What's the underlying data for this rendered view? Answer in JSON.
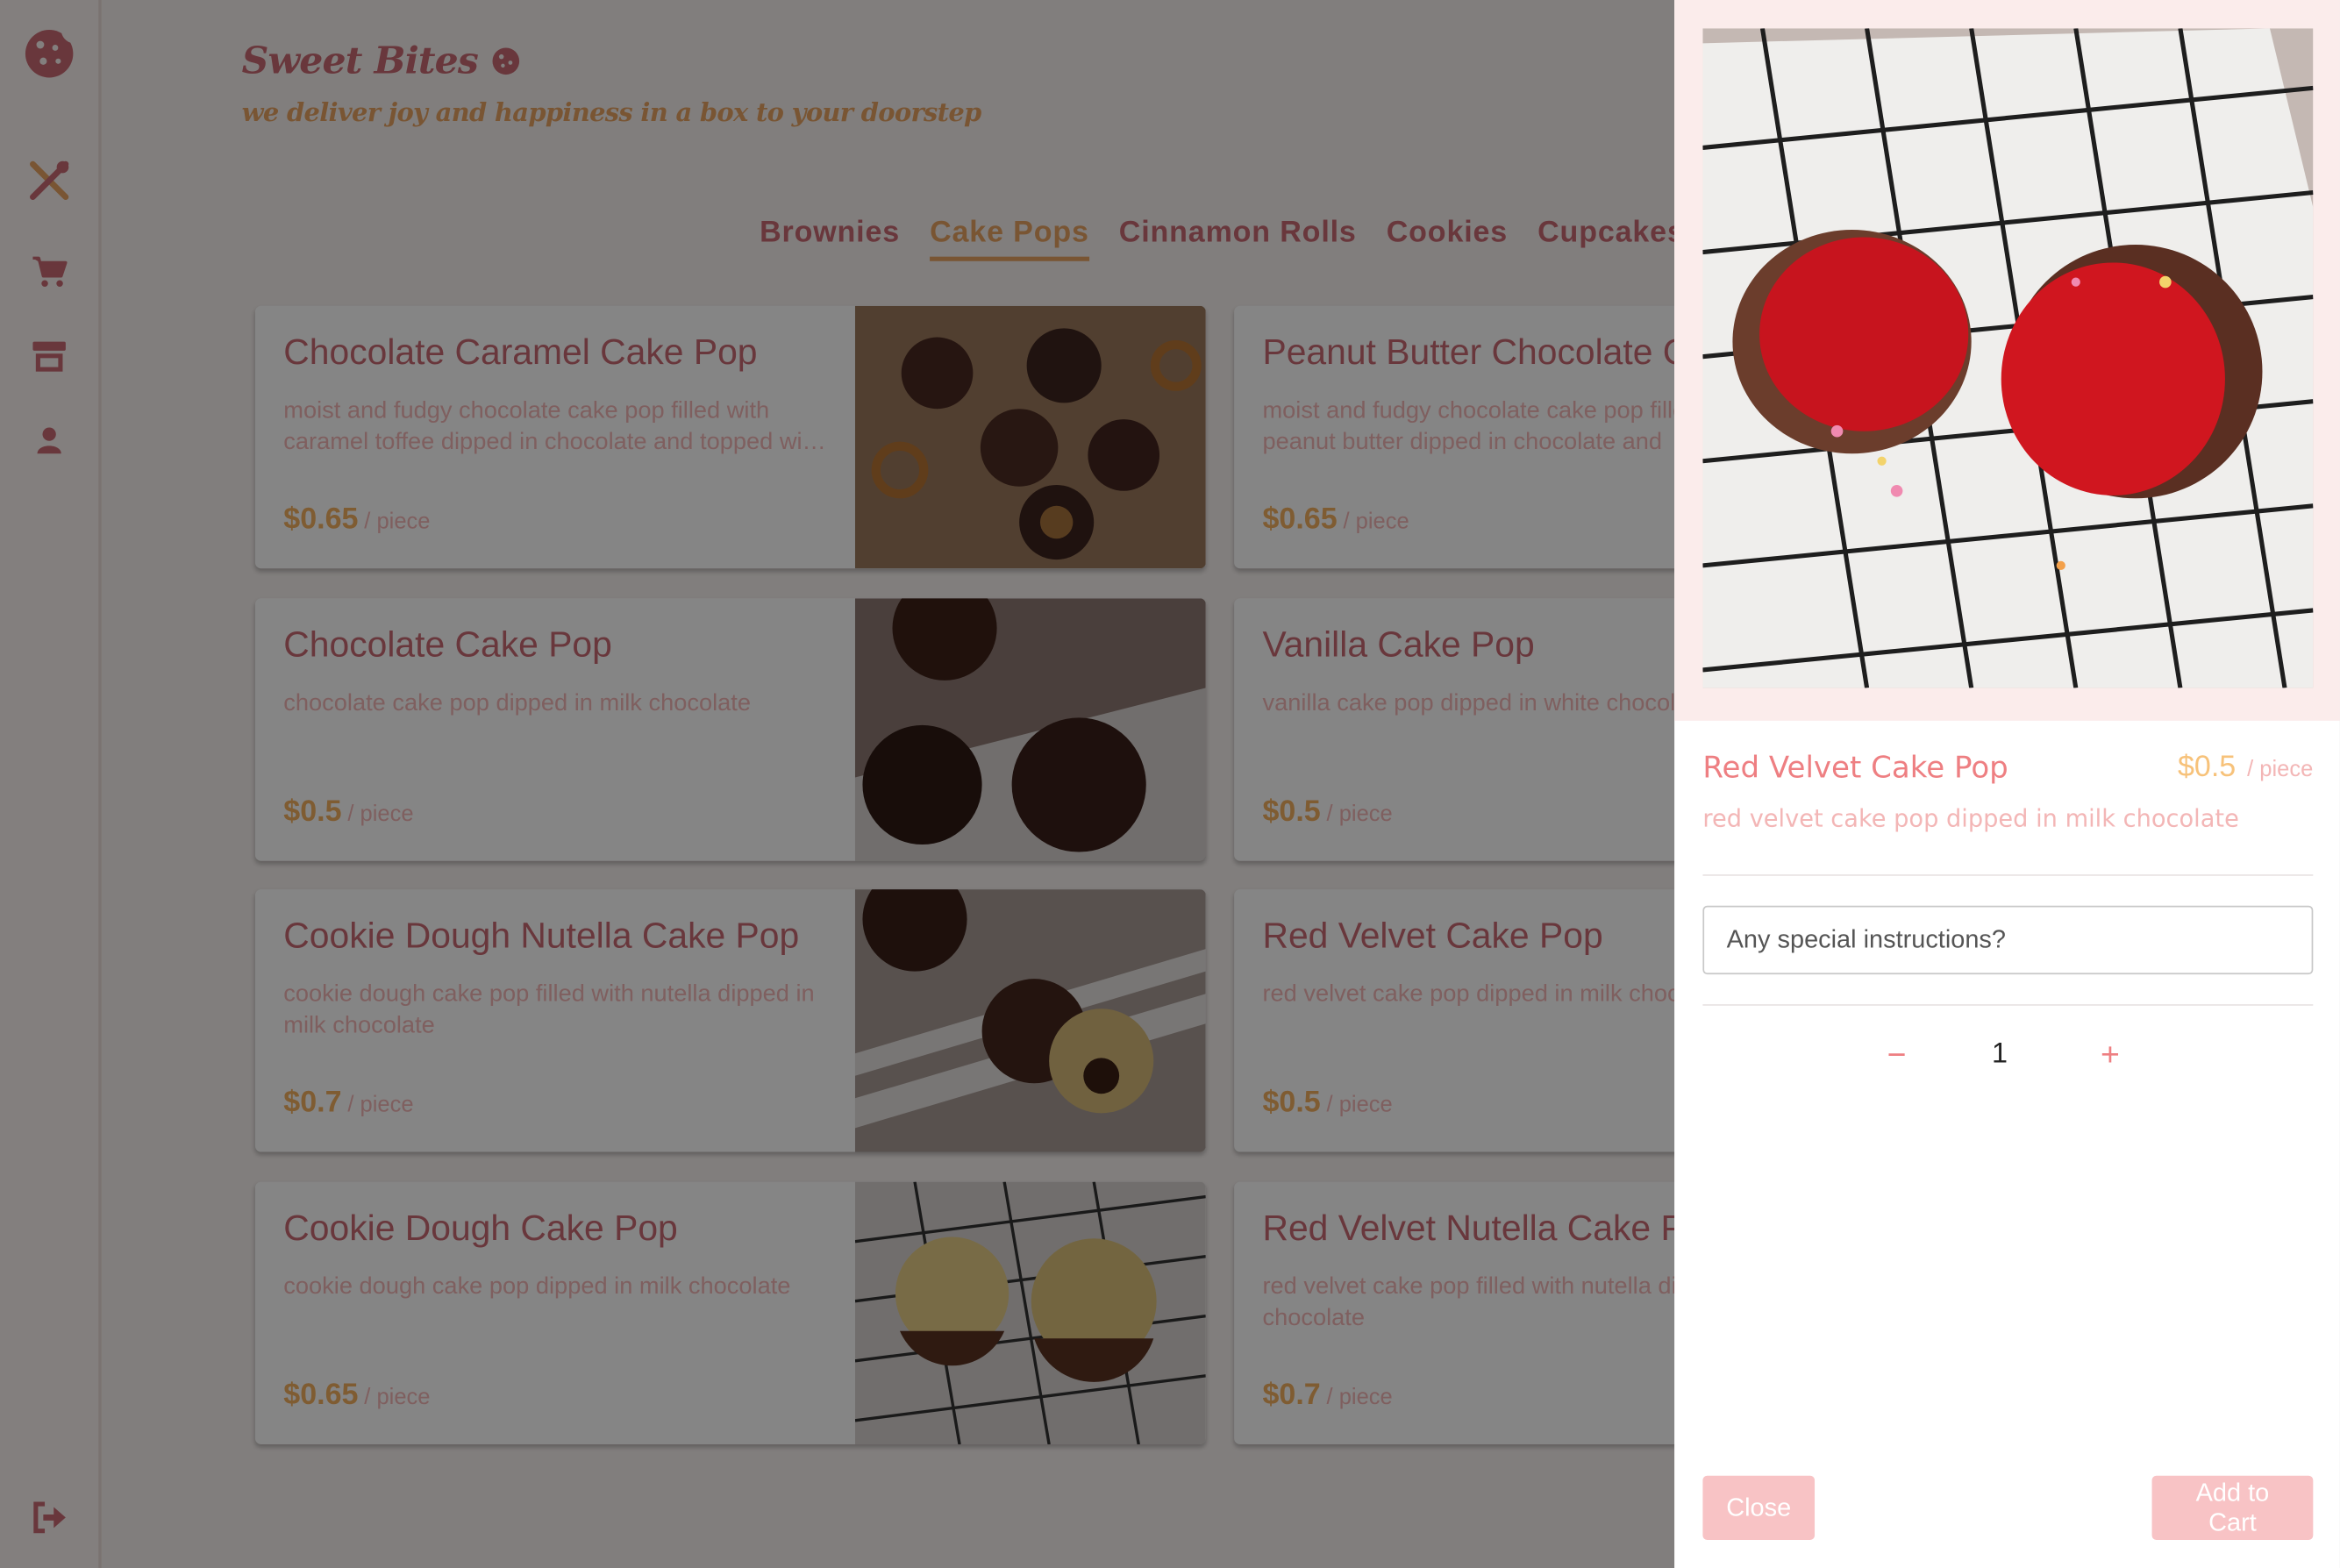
{
  "brand": {
    "name": "Sweet Bites",
    "tagline": "we deliver joy and happiness in a box to your doorstep"
  },
  "sidebar": {
    "items": [
      {
        "icon": "cookie-icon"
      },
      {
        "icon": "utensils-icon"
      },
      {
        "icon": "cart-icon"
      },
      {
        "icon": "store-icon"
      },
      {
        "icon": "user-icon"
      },
      {
        "icon": "logout-icon"
      }
    ]
  },
  "tabs": [
    {
      "label": "Brownies"
    },
    {
      "label": "Cake Pops",
      "active": true
    },
    {
      "label": "Cinnamon Rolls"
    },
    {
      "label": "Cookies"
    },
    {
      "label": "Cupcakes"
    }
  ],
  "products": [
    {
      "name": "Chocolate Caramel Cake Pop",
      "desc": "moist and fudgy chocolate cake pop filled with caramel toffee dipped in chocolate and topped with pretzel",
      "price": "$0.65",
      "unit": "/ piece"
    },
    {
      "name": "Peanut Butter Chocolate Cake Pop",
      "desc": "moist and fudgy chocolate cake pop filled with peanut butter dipped in chocolate and",
      "price": "$0.65",
      "unit": "/ piece"
    },
    {
      "name": "Chocolate Cake Pop",
      "desc": "chocolate cake pop dipped in milk chocolate",
      "price": "$0.5",
      "unit": "/ piece"
    },
    {
      "name": "Vanilla Cake Pop",
      "desc": "vanilla cake pop dipped in white chocolate",
      "price": "$0.5",
      "unit": "/ piece"
    },
    {
      "name": "Cookie Dough Nutella Cake Pop",
      "desc": "cookie dough cake pop filled with nutella dipped in milk chocolate",
      "price": "$0.7",
      "unit": "/ piece"
    },
    {
      "name": "Red Velvet Cake Pop",
      "desc": "red velvet cake pop dipped in milk chocolate",
      "price": "$0.5",
      "unit": "/ piece"
    },
    {
      "name": "Cookie Dough Cake Pop",
      "desc": "cookie dough cake pop dipped in milk chocolate",
      "price": "$0.65",
      "unit": "/ piece"
    },
    {
      "name": "Red Velvet Nutella Cake Pop",
      "desc": "red velvet cake pop filled with nutella dipped in milk chocolate",
      "price": "$0.7",
      "unit": "/ piece"
    }
  ],
  "drawer": {
    "name": "Red Velvet Cake Pop",
    "price": "$0.5",
    "unit": "/ piece",
    "desc": "red velvet cake pop dipped in milk chocolate",
    "instructions_placeholder": "Any special instructions?",
    "quantity": "1",
    "minus": "−",
    "plus": "+",
    "close_label": "Close",
    "add_label": "Add to Cart"
  },
  "colors": {
    "primary": "#c96a73",
    "accent": "#e8a463",
    "pink": "#f8c3c5"
  }
}
